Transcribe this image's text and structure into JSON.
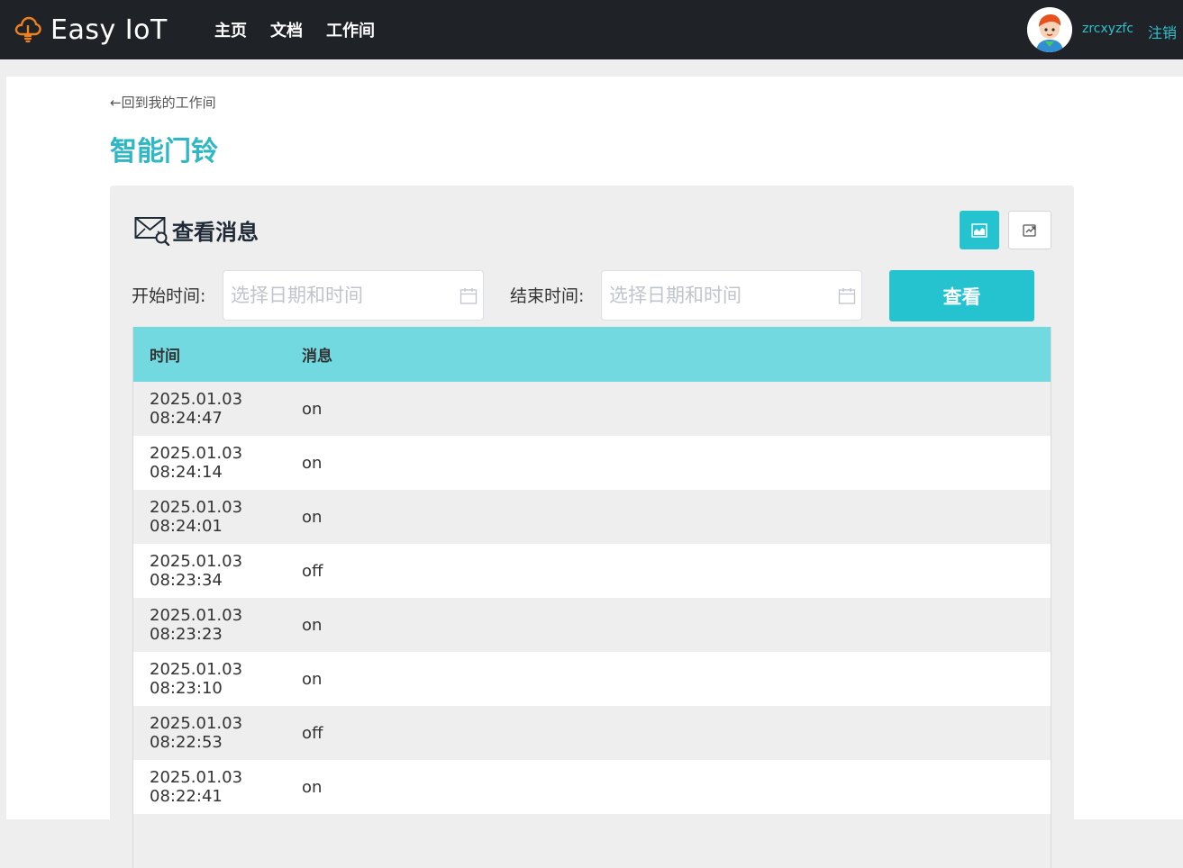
{
  "brand": {
    "name": "Easy IoT",
    "icon": "cloud-bulb-icon",
    "color": "#f0821e"
  },
  "nav": {
    "home": "主页",
    "docs": "文档",
    "workspace": "工作间"
  },
  "user": {
    "name": "zrcxyzfc",
    "logout": "注销"
  },
  "page": {
    "back": "←回到我的工作间",
    "title": "智能门铃"
  },
  "panel": {
    "title": "查看消息",
    "icon": "mail-search-icon",
    "chart_button_icon": "chart-icon",
    "export_button_icon": "export-icon",
    "start_label": "开始时间:",
    "start_placeholder": "选择日期和时间",
    "end_label": "结束时间:",
    "end_placeholder": "选择日期和时间",
    "query_button": "查看"
  },
  "table": {
    "headers": {
      "time": "时间",
      "message": "消息"
    },
    "rows": [
      {
        "time": "2025.01.03 08:24:47",
        "message": "on"
      },
      {
        "time": "2025.01.03 08:24:14",
        "message": "on"
      },
      {
        "time": "2025.01.03 08:24:01",
        "message": "on"
      },
      {
        "time": "2025.01.03 08:23:34",
        "message": "off"
      },
      {
        "time": "2025.01.03 08:23:23",
        "message": "on"
      },
      {
        "time": "2025.01.03 08:23:10",
        "message": "on"
      },
      {
        "time": "2025.01.03 08:22:53",
        "message": "off"
      },
      {
        "time": "2025.01.03 08:22:41",
        "message": "on"
      }
    ]
  },
  "colors": {
    "navbar": "#1f2227",
    "accent": "#24c3cf",
    "table_header": "#72d9e0",
    "title": "#2fb8c4"
  }
}
